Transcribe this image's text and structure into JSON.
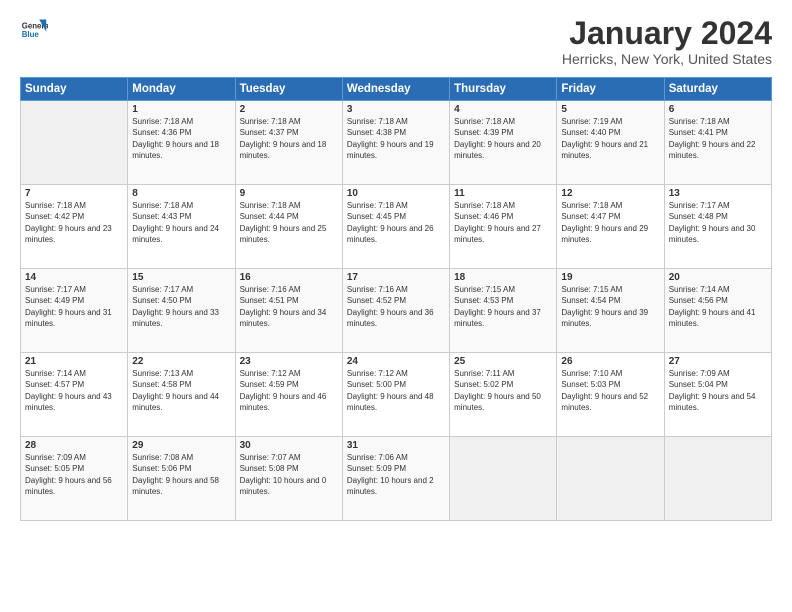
{
  "header": {
    "logo_general": "General",
    "logo_blue": "Blue",
    "title": "January 2024",
    "subtitle": "Herricks, New York, United States"
  },
  "weekdays": [
    "Sunday",
    "Monday",
    "Tuesday",
    "Wednesday",
    "Thursday",
    "Friday",
    "Saturday"
  ],
  "weeks": [
    [
      {
        "day": "",
        "sunrise": "",
        "sunset": "",
        "daylight": "",
        "empty": true
      },
      {
        "day": "1",
        "sunrise": "Sunrise: 7:18 AM",
        "sunset": "Sunset: 4:36 PM",
        "daylight": "Daylight: 9 hours and 18 minutes."
      },
      {
        "day": "2",
        "sunrise": "Sunrise: 7:18 AM",
        "sunset": "Sunset: 4:37 PM",
        "daylight": "Daylight: 9 hours and 18 minutes."
      },
      {
        "day": "3",
        "sunrise": "Sunrise: 7:18 AM",
        "sunset": "Sunset: 4:38 PM",
        "daylight": "Daylight: 9 hours and 19 minutes."
      },
      {
        "day": "4",
        "sunrise": "Sunrise: 7:18 AM",
        "sunset": "Sunset: 4:39 PM",
        "daylight": "Daylight: 9 hours and 20 minutes."
      },
      {
        "day": "5",
        "sunrise": "Sunrise: 7:19 AM",
        "sunset": "Sunset: 4:40 PM",
        "daylight": "Daylight: 9 hours and 21 minutes."
      },
      {
        "day": "6",
        "sunrise": "Sunrise: 7:18 AM",
        "sunset": "Sunset: 4:41 PM",
        "daylight": "Daylight: 9 hours and 22 minutes."
      }
    ],
    [
      {
        "day": "7",
        "sunrise": "Sunrise: 7:18 AM",
        "sunset": "Sunset: 4:42 PM",
        "daylight": "Daylight: 9 hours and 23 minutes."
      },
      {
        "day": "8",
        "sunrise": "Sunrise: 7:18 AM",
        "sunset": "Sunset: 4:43 PM",
        "daylight": "Daylight: 9 hours and 24 minutes."
      },
      {
        "day": "9",
        "sunrise": "Sunrise: 7:18 AM",
        "sunset": "Sunset: 4:44 PM",
        "daylight": "Daylight: 9 hours and 25 minutes."
      },
      {
        "day": "10",
        "sunrise": "Sunrise: 7:18 AM",
        "sunset": "Sunset: 4:45 PM",
        "daylight": "Daylight: 9 hours and 26 minutes."
      },
      {
        "day": "11",
        "sunrise": "Sunrise: 7:18 AM",
        "sunset": "Sunset: 4:46 PM",
        "daylight": "Daylight: 9 hours and 27 minutes."
      },
      {
        "day": "12",
        "sunrise": "Sunrise: 7:18 AM",
        "sunset": "Sunset: 4:47 PM",
        "daylight": "Daylight: 9 hours and 29 minutes."
      },
      {
        "day": "13",
        "sunrise": "Sunrise: 7:17 AM",
        "sunset": "Sunset: 4:48 PM",
        "daylight": "Daylight: 9 hours and 30 minutes."
      }
    ],
    [
      {
        "day": "14",
        "sunrise": "Sunrise: 7:17 AM",
        "sunset": "Sunset: 4:49 PM",
        "daylight": "Daylight: 9 hours and 31 minutes."
      },
      {
        "day": "15",
        "sunrise": "Sunrise: 7:17 AM",
        "sunset": "Sunset: 4:50 PM",
        "daylight": "Daylight: 9 hours and 33 minutes."
      },
      {
        "day": "16",
        "sunrise": "Sunrise: 7:16 AM",
        "sunset": "Sunset: 4:51 PM",
        "daylight": "Daylight: 9 hours and 34 minutes."
      },
      {
        "day": "17",
        "sunrise": "Sunrise: 7:16 AM",
        "sunset": "Sunset: 4:52 PM",
        "daylight": "Daylight: 9 hours and 36 minutes."
      },
      {
        "day": "18",
        "sunrise": "Sunrise: 7:15 AM",
        "sunset": "Sunset: 4:53 PM",
        "daylight": "Daylight: 9 hours and 37 minutes."
      },
      {
        "day": "19",
        "sunrise": "Sunrise: 7:15 AM",
        "sunset": "Sunset: 4:54 PM",
        "daylight": "Daylight: 9 hours and 39 minutes."
      },
      {
        "day": "20",
        "sunrise": "Sunrise: 7:14 AM",
        "sunset": "Sunset: 4:56 PM",
        "daylight": "Daylight: 9 hours and 41 minutes."
      }
    ],
    [
      {
        "day": "21",
        "sunrise": "Sunrise: 7:14 AM",
        "sunset": "Sunset: 4:57 PM",
        "daylight": "Daylight: 9 hours and 43 minutes."
      },
      {
        "day": "22",
        "sunrise": "Sunrise: 7:13 AM",
        "sunset": "Sunset: 4:58 PM",
        "daylight": "Daylight: 9 hours and 44 minutes."
      },
      {
        "day": "23",
        "sunrise": "Sunrise: 7:12 AM",
        "sunset": "Sunset: 4:59 PM",
        "daylight": "Daylight: 9 hours and 46 minutes."
      },
      {
        "day": "24",
        "sunrise": "Sunrise: 7:12 AM",
        "sunset": "Sunset: 5:00 PM",
        "daylight": "Daylight: 9 hours and 48 minutes."
      },
      {
        "day": "25",
        "sunrise": "Sunrise: 7:11 AM",
        "sunset": "Sunset: 5:02 PM",
        "daylight": "Daylight: 9 hours and 50 minutes."
      },
      {
        "day": "26",
        "sunrise": "Sunrise: 7:10 AM",
        "sunset": "Sunset: 5:03 PM",
        "daylight": "Daylight: 9 hours and 52 minutes."
      },
      {
        "day": "27",
        "sunrise": "Sunrise: 7:09 AM",
        "sunset": "Sunset: 5:04 PM",
        "daylight": "Daylight: 9 hours and 54 minutes."
      }
    ],
    [
      {
        "day": "28",
        "sunrise": "Sunrise: 7:09 AM",
        "sunset": "Sunset: 5:05 PM",
        "daylight": "Daylight: 9 hours and 56 minutes."
      },
      {
        "day": "29",
        "sunrise": "Sunrise: 7:08 AM",
        "sunset": "Sunset: 5:06 PM",
        "daylight": "Daylight: 9 hours and 58 minutes."
      },
      {
        "day": "30",
        "sunrise": "Sunrise: 7:07 AM",
        "sunset": "Sunset: 5:08 PM",
        "daylight": "Daylight: 10 hours and 0 minutes."
      },
      {
        "day": "31",
        "sunrise": "Sunrise: 7:06 AM",
        "sunset": "Sunset: 5:09 PM",
        "daylight": "Daylight: 10 hours and 2 minutes."
      },
      {
        "day": "",
        "sunrise": "",
        "sunset": "",
        "daylight": "",
        "empty": true
      },
      {
        "day": "",
        "sunrise": "",
        "sunset": "",
        "daylight": "",
        "empty": true
      },
      {
        "day": "",
        "sunrise": "",
        "sunset": "",
        "daylight": "",
        "empty": true
      }
    ]
  ]
}
